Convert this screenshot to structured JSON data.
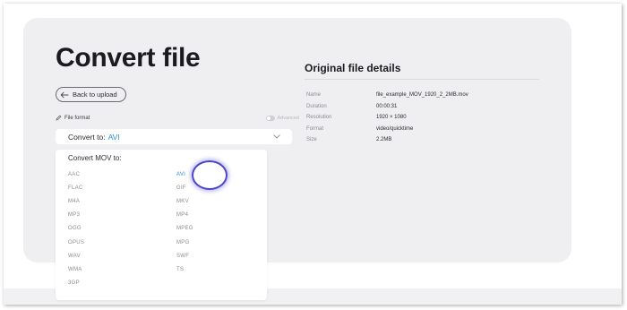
{
  "page": {
    "title": "Convert file",
    "back_label": "Back to upload",
    "file_format_label": "File format",
    "advanced_label": "Advanced"
  },
  "select": {
    "prefix": "Convert to:",
    "value": "AVI"
  },
  "dropdown": {
    "title": "Convert MOV to:",
    "left_options": [
      "AAC",
      "FLAC",
      "M4A",
      "MP3",
      "OGG",
      "OPUS",
      "WAV",
      "WMA",
      "3GP"
    ],
    "right_options": [
      "AVI",
      "GIF",
      "MKV",
      "MP4",
      "MPEG",
      "MPG",
      "SWF",
      "TS"
    ],
    "selected": "AVI"
  },
  "details": {
    "title": "Original file details",
    "rows": [
      {
        "label": "Name",
        "value": "file_example_MOV_1920_2_2MB.mov"
      },
      {
        "label": "Duration",
        "value": "00:00:31"
      },
      {
        "label": "Resolution",
        "value": "1920 × 1080"
      },
      {
        "label": "Format",
        "value": "video/quicktime"
      },
      {
        "label": "Size",
        "value": "2.2MB"
      }
    ]
  },
  "icons": {
    "back": "arrow-left-icon",
    "file_format": "pencil-icon",
    "select": "chevron-down-icon"
  },
  "colors": {
    "accent": "#2f8fdb",
    "card_bg": "#efeff1",
    "highlight_ring": "#4a46c8"
  }
}
